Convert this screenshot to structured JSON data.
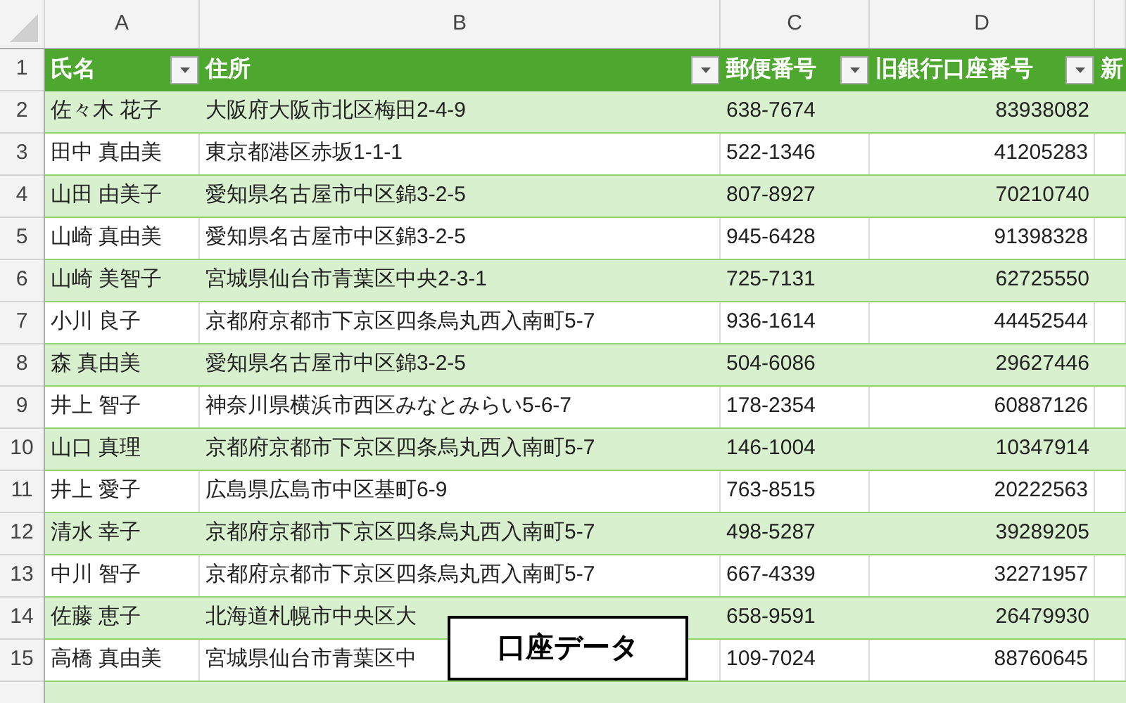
{
  "column_letters": [
    "A",
    "B",
    "C",
    "D"
  ],
  "row_numbers": [
    "1",
    "2",
    "3",
    "4",
    "5",
    "6",
    "7",
    "8",
    "9",
    "10",
    "11",
    "12",
    "13",
    "14",
    "15"
  ],
  "table": {
    "columns": [
      {
        "label": "氏名",
        "filter": true
      },
      {
        "label": "住所",
        "filter": true
      },
      {
        "label": "郵便番号",
        "filter": true
      },
      {
        "label": "旧銀行口座番号",
        "filter": true
      },
      {
        "label": "新",
        "filter": false
      }
    ],
    "rows": [
      [
        "佐々木 花子",
        "大阪府大阪市北区梅田2-4-9",
        "638-7674",
        "83938082"
      ],
      [
        "田中 真由美",
        "東京都港区赤坂1-1-1",
        "522-1346",
        "41205283"
      ],
      [
        "山田 由美子",
        "愛知県名古屋市中区錦3-2-5",
        "807-8927",
        "70210740"
      ],
      [
        "山崎 真由美",
        "愛知県名古屋市中区錦3-2-5",
        "945-6428",
        "91398328"
      ],
      [
        "山崎 美智子",
        "宮城県仙台市青葉区中央2-3-1",
        "725-7131",
        "62725550"
      ],
      [
        "小川 良子",
        "京都府京都市下京区四条烏丸西入南町5-7",
        "936-1614",
        "44452544"
      ],
      [
        "森 真由美",
        "愛知県名古屋市中区錦3-2-5",
        "504-6086",
        "29627446"
      ],
      [
        "井上 智子",
        "神奈川県横浜市西区みなとみらい5-6-7",
        "178-2354",
        "60887126"
      ],
      [
        "山口 真理",
        "京都府京都市下京区四条烏丸西入南町5-7",
        "146-1004",
        "10347914"
      ],
      [
        "井上 愛子",
        "広島県広島市中区基町6-9",
        "763-8515",
        "20222563"
      ],
      [
        "清水 幸子",
        "京都府京都市下京区四条烏丸西入南町5-7",
        "498-5287",
        "39289205"
      ],
      [
        "中川 智子",
        "京都府京都市下京区四条烏丸西入南町5-7",
        "667-4339",
        "32271957"
      ],
      [
        "佐藤 恵子",
        "北海道札幌市中央区大",
        "658-9591",
        "26479930"
      ],
      [
        "高橋 真由美",
        "宮城県仙台市青葉区中",
        "109-7024",
        "88760645"
      ]
    ]
  },
  "caption": "口座データ"
}
